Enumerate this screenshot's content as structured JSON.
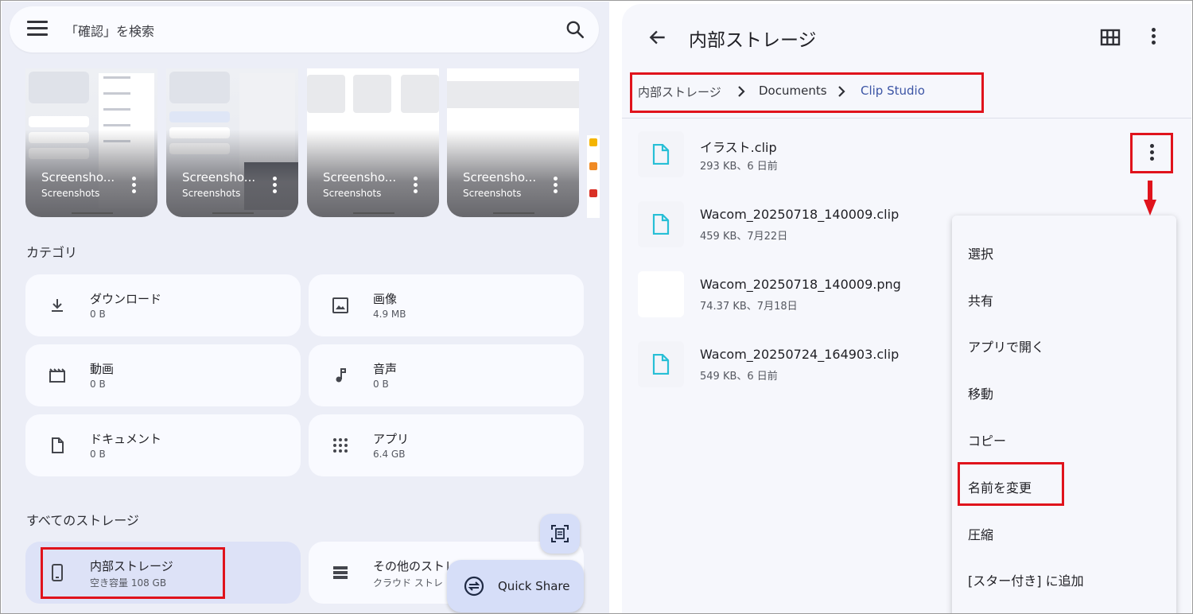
{
  "search": {
    "placeholder": "「確認」を検索"
  },
  "screenshots": [
    {
      "title": "Screensho...",
      "subtitle": "Screenshots"
    },
    {
      "title": "Screensho...",
      "subtitle": "Screenshots"
    },
    {
      "title": "Screensho...",
      "subtitle": "Screenshots"
    },
    {
      "title": "Screensho...",
      "subtitle": "Screenshots"
    }
  ],
  "categories": {
    "heading": "カテゴリ",
    "items": [
      {
        "name": "ダウンロード",
        "size": "0 B",
        "icon": "download-icon"
      },
      {
        "name": "画像",
        "size": "4.9 MB",
        "icon": "image-icon"
      },
      {
        "name": "動画",
        "size": "0 B",
        "icon": "video-icon"
      },
      {
        "name": "音声",
        "size": "0 B",
        "icon": "audio-icon"
      },
      {
        "name": "ドキュメント",
        "size": "0 B",
        "icon": "document-icon"
      },
      {
        "name": "アプリ",
        "size": "6.4 GB",
        "icon": "apps-icon"
      }
    ]
  },
  "storage": {
    "heading": "すべてのストレージ",
    "items": [
      {
        "name": "内部ストレージ",
        "detail": "空き容量 108 GB"
      },
      {
        "name": "その他のストレ",
        "detail": "クラウド ストレ"
      }
    ]
  },
  "quick_share": {
    "label": "Quick Share"
  },
  "right": {
    "title": "内部ストレージ",
    "breadcrumb": [
      "内部ストレージ",
      "Documents",
      "Clip Studio"
    ],
    "files": [
      {
        "name": "イラスト.clip",
        "meta": "293 KB、6 日前"
      },
      {
        "name": "Wacom_20250718_140009.clip",
        "meta": "459 KB、7月22日"
      },
      {
        "name": "Wacom_20250718_140009.png",
        "meta": "74.37 KB、7月18日"
      },
      {
        "name": "Wacom_20250724_164903.clip",
        "meta": "549 KB、6 日前"
      }
    ],
    "menu": [
      "選択",
      "共有",
      "アプリで開く",
      "移動",
      "コピー",
      "名前を変更",
      "圧縮",
      "[スター付き] に追加"
    ]
  },
  "colors": {
    "accent": "#3c55a5",
    "file_icon": "#27bfd6",
    "highlight": "#e0131c"
  }
}
